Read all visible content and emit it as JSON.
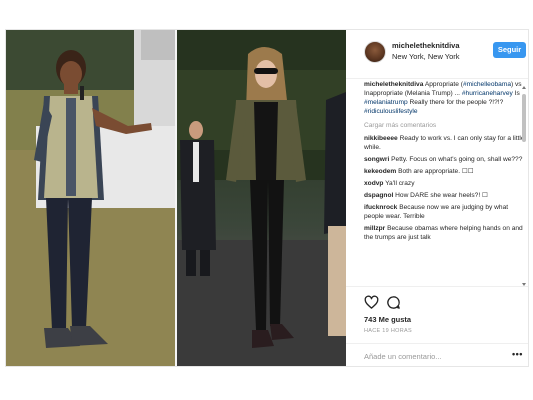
{
  "header": {
    "username": "micheletheknitdiva",
    "location": "New York, New York",
    "follow_label": "Seguir"
  },
  "caption": {
    "username": "micheletheknitdiva",
    "segments": [
      {
        "text": " Appropriate (",
        "tag": false
      },
      {
        "text": "#michelleobama",
        "tag": true
      },
      {
        "text": ") vs Inappropriate (Melania Trump) ... ",
        "tag": false
      },
      {
        "text": "#hurricaneharvey",
        "tag": true
      },
      {
        "text": " Is ",
        "tag": false
      },
      {
        "text": "#melaniatrump",
        "tag": true
      },
      {
        "text": " Really there for the people ?!?!? ",
        "tag": false
      },
      {
        "text": "#ridiculouslifestyle",
        "tag": true
      }
    ]
  },
  "load_more_label": "Cargar más comentarios",
  "comments": [
    {
      "username": "nikkibeeee",
      "text": "Ready to work vs. I can only stay for a little while."
    },
    {
      "username": "songwri",
      "text": "Petty. Focus on what's going on, shall we???"
    },
    {
      "username": "kekeodem",
      "text": "Both are appropriate. ☐☐"
    },
    {
      "username": "xodvp",
      "text": "Ya'll crazy"
    },
    {
      "username": "dspagnol",
      "text": "How DARE she wear heels?! ☐"
    },
    {
      "username": "ifucknrock",
      "text": "Because now we are judging by what people wear. Terrible"
    },
    {
      "username": "millzpr",
      "text": "Because obamas where helping hands on and the trumps are just talk"
    }
  ],
  "likes_label": "743 Me gusta",
  "timestamp": "HACE 19 HORAS",
  "add_comment_placeholder": "Añade un comentario...",
  "more_options": "•••",
  "icons": {
    "like": "heart-icon",
    "comment": "comment-icon",
    "more": "more-options-icon"
  },
  "colors": {
    "follow_button": "#3897f0",
    "hashtag": "#003569",
    "muted_text": "#999999"
  }
}
